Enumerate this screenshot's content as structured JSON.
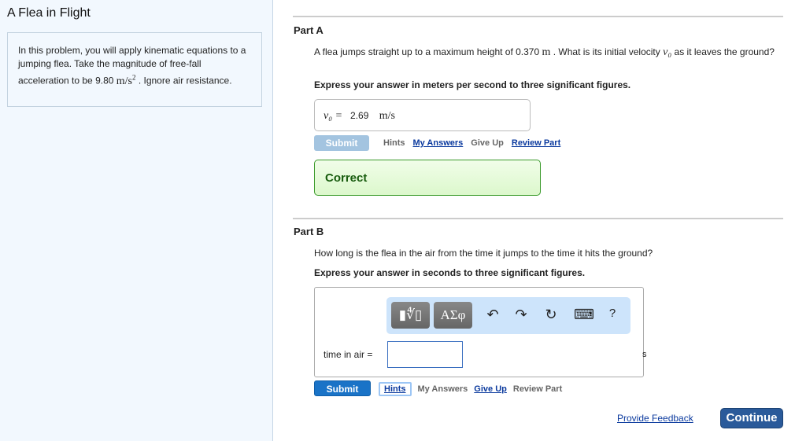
{
  "title": "A Flea in Flight",
  "intro": {
    "pre": "In this problem, you will apply kinematic equations to a jumping flea. Take the magnitude of free-fall acceleration to be 9.80 ",
    "unit": "m/s",
    "exp": "2",
    "post": " . Ignore air resistance."
  },
  "partA": {
    "label": "Part A",
    "q_pre": "A flea jumps straight up to a maximum height of 0.370 ",
    "q_unit": "m",
    "q_mid": " . What is its initial velocity ",
    "q_var": "v₀",
    "q_post": " as it leaves the ground?",
    "instr": "Express your answer in meters per second to three significant figures.",
    "ans_var": "v₀ =",
    "ans_val": "2.69",
    "ans_unit": "m/s",
    "submit": "Submit",
    "hints": "Hints",
    "my_answers": "My Answers",
    "give_up": "Give Up",
    "review": "Review Part",
    "result": "Correct"
  },
  "partB": {
    "label": "Part B",
    "question": "How long is the flea in the air from the time it jumps to the time it hits the ground?",
    "instr": "Express your answer in seconds to three significant figures.",
    "toolbar": {
      "templates": "▮∜▯",
      "greek": "ΑΣφ",
      "undo": "↶",
      "redo": "↷",
      "reset": "↻",
      "keyboard": "⌨",
      "help": "?"
    },
    "input_label": "time in air =",
    "input_value": "",
    "unit": "s",
    "submit": "Submit",
    "hints": "Hints",
    "my_answers": "My Answers",
    "give_up": "Give Up",
    "review": "Review Part"
  },
  "footer": {
    "feedback": "Provide Feedback",
    "continue": "Continue"
  },
  "colors": {
    "submit_active": "#1a73c7",
    "submit_disabled": "#a3c4e0",
    "continue": "#2a5a9a",
    "correct_border": "#3a9a2a"
  }
}
